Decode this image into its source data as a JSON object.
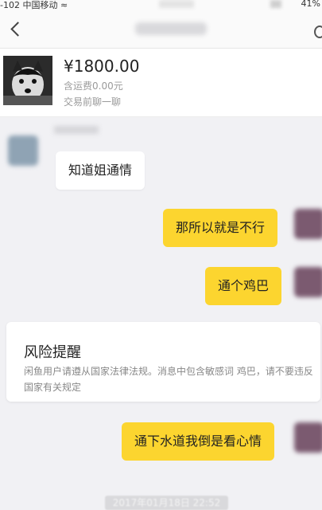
{
  "status_bar": {
    "carrier": "-102 中国移动",
    "wifi_icon": "wifi-icon",
    "battery": "41%"
  },
  "nav": {
    "back_icon": "chevron-left-icon",
    "more_icon": "circle-icon"
  },
  "product": {
    "price": "¥1800.00",
    "shipping": "含运费0.00元",
    "chat_first": "交易前聊一聊"
  },
  "messages": [
    {
      "side": "in",
      "text": "知道姐通情"
    },
    {
      "side": "out",
      "text": "那所以就是不行"
    },
    {
      "side": "out",
      "text": "通个鸡巴"
    },
    {
      "side": "out",
      "text": "通下水道我倒是看心情"
    }
  ],
  "risk_notice": {
    "title": "风险提醒",
    "body": "闲鱼用户请遵从国家法律法规。消息中包含敏感词 鸡巴，请不要违反国家有关规定"
  },
  "timestamp": "2017年01月18日 22:52",
  "colors": {
    "outgoing_bubble": "#fcd52f",
    "background": "#f1f1f4"
  }
}
